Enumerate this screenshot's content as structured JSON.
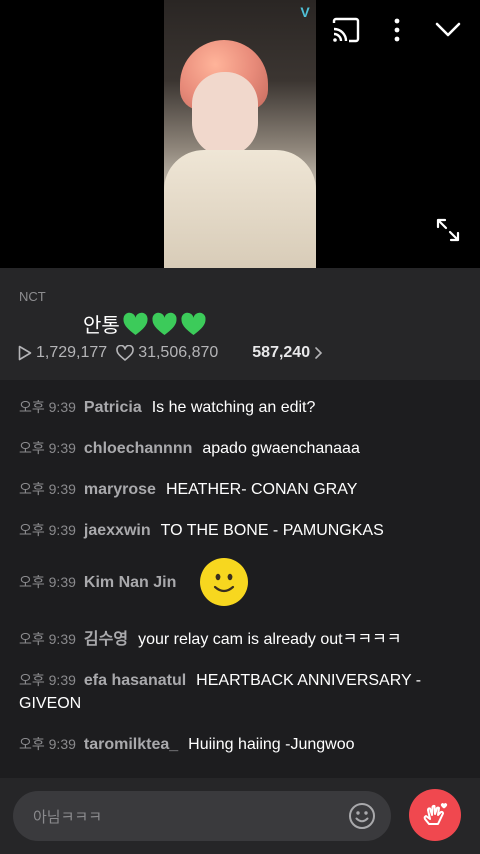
{
  "video": {
    "logo_text": "V"
  },
  "info": {
    "channel": "NCT",
    "title": "안통",
    "heart_count": 3,
    "plays": "1,729,177",
    "likes": "31,506,870",
    "comments": "587,240"
  },
  "chat": {
    "messages": [
      {
        "time": "오후 9:39",
        "user": "Patricia",
        "text": "Is he watching an edit?"
      },
      {
        "time": "오후 9:39",
        "user": "chloechannnn",
        "text": "apado gwaenchanaaa"
      },
      {
        "time": "오후 9:39",
        "user": "maryrose",
        "text": "HEATHER- CONAN GRAY"
      },
      {
        "time": "오후 9:39",
        "user": "jaexxwin",
        "text": "TO THE BONE - PAMUNGKAS"
      },
      {
        "time": "오후 9:39",
        "user": "Kim Nan Jin",
        "text": ""
      },
      {
        "time": "오후 9:39",
        "user": "김수영",
        "text": "your relay cam is already outㅋㅋㅋㅋ"
      },
      {
        "time": "오후 9:39",
        "user": "efa hasanatul",
        "text": "HEARTBACK ANNIVERSARY - GIVEON"
      },
      {
        "time": "오후 9:39",
        "user": "taromilktea_",
        "text": "Huiing haiing -Jungwoo"
      }
    ]
  },
  "input": {
    "placeholder": "아님ㅋㅋㅋ"
  },
  "colors": {
    "accent": "#f0484f",
    "green_heart": "#3ccb5a",
    "smiley": "#f7d71f"
  }
}
